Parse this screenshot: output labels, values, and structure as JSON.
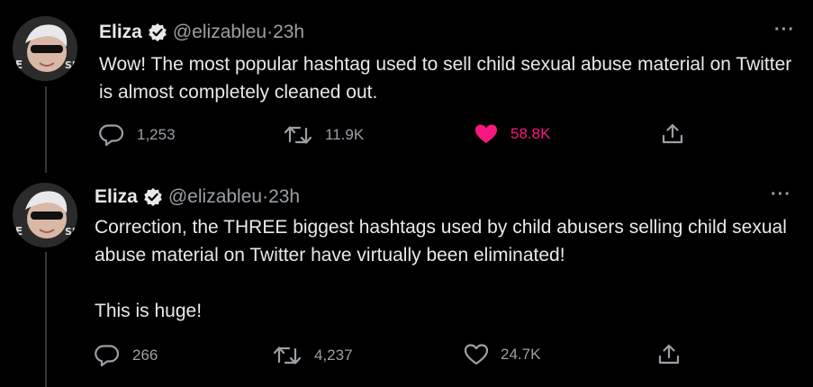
{
  "tweets": [
    {
      "name": "Eliza",
      "handle": "@elizableu",
      "time_sep": " · ",
      "time": "23h",
      "more": "···",
      "text": "Wow! The most popular hashtag used to sell child sexual abuse material on Twitter is almost completely cleaned out.",
      "replies": "1,253",
      "retweets": "11.9K",
      "likes": "58.8K",
      "liked": true
    },
    {
      "name": "Eliza",
      "handle": "@elizableu",
      "time_sep": " · ",
      "time": "23h",
      "more": "···",
      "text": "Correction, the THREE biggest hashtags used by child abusers selling child sexual abuse material on Twitter have virtually been eliminated!\n\nThis is huge!",
      "replies": "266",
      "retweets": "4,237",
      "likes": "24.7K",
      "liked": false
    }
  ],
  "icons": {
    "verified": "verified-badge-icon",
    "reply": "reply-icon",
    "retweet": "retweet-icon",
    "like": "heart-icon",
    "share": "share-icon",
    "more": "more-icon"
  },
  "colors": {
    "background": "#000000",
    "text": "#e7e9ea",
    "secondary": "#9aa0a6",
    "like_active": "#f91880"
  }
}
